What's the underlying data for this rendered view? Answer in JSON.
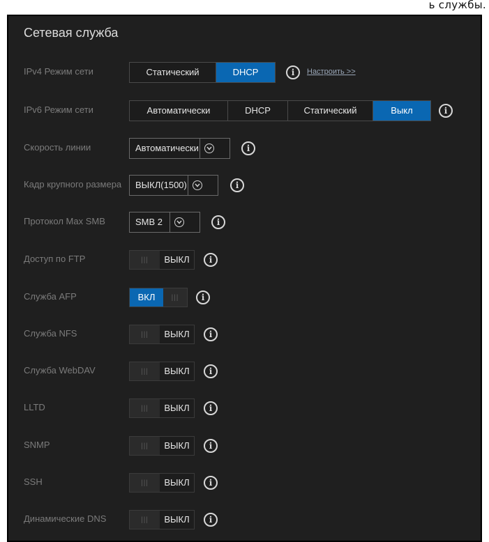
{
  "top_caption": "ь службы.",
  "panel": {
    "title": "Сетевая служба"
  },
  "ipv4": {
    "label": "IPv4 Режим сети",
    "options": [
      "Статический",
      "DHCP"
    ],
    "selected": "DHCP",
    "configure_link": "Настроить >>"
  },
  "ipv6": {
    "label": "IPv6 Режим сети",
    "options": [
      "Автоматически",
      "DHCP",
      "Статический",
      "Выкл"
    ],
    "selected": "Выкл"
  },
  "line_speed": {
    "label": "Скорость линии",
    "value": "Автоматически"
  },
  "jumbo_frame": {
    "label": "Кадр крупного размера",
    "value": "ВЫКЛ(1500)"
  },
  "smb_protocol": {
    "label": "Протокол Max SMB",
    "value": "SMB 2"
  },
  "toggles": [
    {
      "label": "Доступ по FTP",
      "state": "ВЫКЛ",
      "on": false
    },
    {
      "label": "Служба AFP",
      "state": "ВКЛ",
      "on": true
    },
    {
      "label": "Служба NFS",
      "state": "ВЫКЛ",
      "on": false
    },
    {
      "label": "Служба WebDAV",
      "state": "ВЫКЛ",
      "on": false
    },
    {
      "label": "LLTD",
      "state": "ВЫКЛ",
      "on": false
    },
    {
      "label": "SNMP",
      "state": "ВЫКЛ",
      "on": false
    },
    {
      "label": "SSH",
      "state": "ВЫКЛ",
      "on": false
    },
    {
      "label": "Динамические DNS",
      "state": "ВЫКЛ",
      "on": false
    }
  ],
  "toggle_grip_glyph": "|||",
  "info_icon_glyph": "i",
  "colors": {
    "accent": "#0a67b2",
    "panel_bg": "#1f1f1f",
    "label_text": "#7b7b7b"
  }
}
